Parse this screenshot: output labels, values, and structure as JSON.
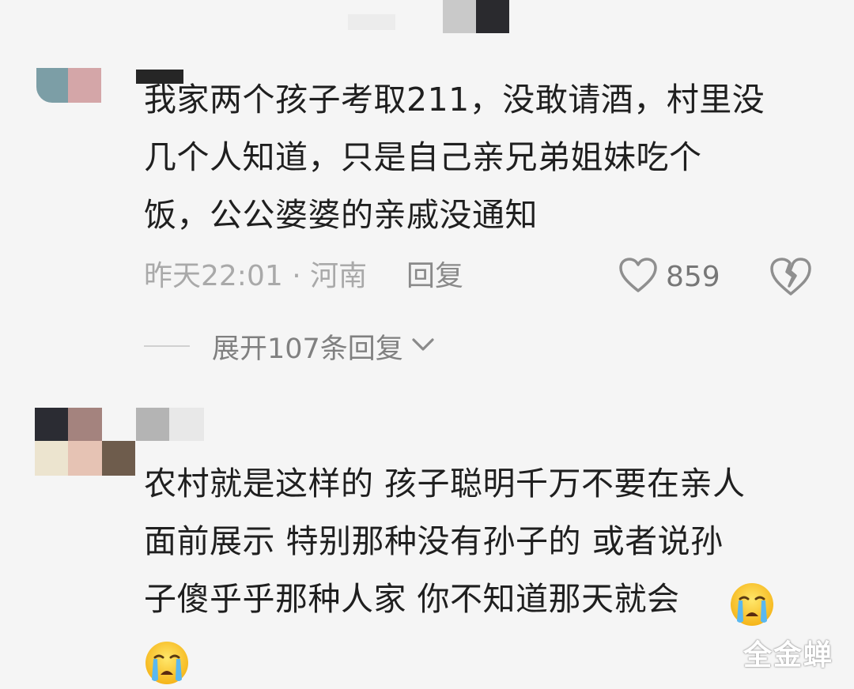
{
  "colors": {
    "background": "#f5f5f5",
    "text": "#1f1f1f",
    "meta": "#a9a9a9",
    "icon": "#8f8f8f"
  },
  "comments": [
    {
      "lines": [
        "我家两个孩子考取211，没敢请酒，村里没",
        "几个人知道，只是自己亲兄弟姐妹吃个",
        "饭，公公婆婆的亲戚没通知"
      ],
      "time_location": "昨天22:01 · 河南",
      "reply_label": "回复",
      "like_count": "859",
      "expand_label": "展开107条回复"
    },
    {
      "lines": [
        "农村就是这样的  孩子聪明千万不要在亲人",
        "面前展示  特别那种没有孙子的    或者说孙",
        "子傻乎乎那种人家  你不知道那天就会"
      ],
      "emojis": [
        "crying-face-emoji",
        "crying-face-emoji"
      ]
    }
  ],
  "watermark": "全金蝉"
}
